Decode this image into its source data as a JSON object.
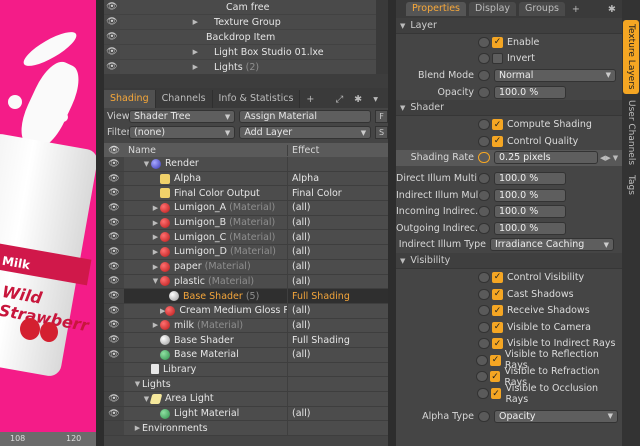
{
  "viewport": {
    "can_brand": "Milk",
    "can_flavor": "Wild Strawberr",
    "ruler": [
      "108",
      "120"
    ]
  },
  "scene_list": [
    {
      "label": "Cam free",
      "count": ""
    },
    {
      "label": "Texture Group",
      "count": ""
    },
    {
      "label": "Backdrop Item",
      "count": ""
    },
    {
      "label": "Light Box Studio 01.lxe",
      "count": ""
    },
    {
      "label": "Lights",
      "count": "(2)"
    }
  ],
  "shading_panel": {
    "tabs": [
      "Shading",
      "Channels",
      "Info & Statistics"
    ],
    "plus": "+",
    "view_label": "View",
    "view_value": "Shader Tree",
    "assign_button": "Assign Material",
    "f_button": "F",
    "filter_label": "Filter",
    "filter_value": "(none)",
    "add_layer_button": "Add Layer",
    "s_button": "S",
    "col_name": "Name",
    "col_effect": "Effect",
    "rows": [
      {
        "name": "Render",
        "tag": "",
        "effect": ""
      },
      {
        "name": "Alpha",
        "tag": "",
        "effect": "Alpha"
      },
      {
        "name": "Final Color Output",
        "tag": "",
        "effect": "Final Color"
      },
      {
        "name": "Lumigon_A",
        "tag": "(Material)",
        "effect": "(all)"
      },
      {
        "name": "Lumigon_B",
        "tag": "(Material)",
        "effect": "(all)"
      },
      {
        "name": "Lumigon_C",
        "tag": "(Material)",
        "effect": "(all)"
      },
      {
        "name": "Lumigon_D",
        "tag": "(Material)",
        "effect": "(all)"
      },
      {
        "name": "paper",
        "tag": "(Material)",
        "effect": "(all)"
      },
      {
        "name": "plastic",
        "tag": "(Material)",
        "effect": "(all)"
      },
      {
        "name": "Base Shader",
        "tag": "(5)",
        "effect": "Full Shading"
      },
      {
        "name": "Cream Medium Gloss Pl...",
        "tag": "",
        "effect": "(all)"
      },
      {
        "name": "milk",
        "tag": "(Material)",
        "effect": "(all)"
      },
      {
        "name": "Base Shader",
        "tag": "",
        "effect": "Full Shading"
      },
      {
        "name": "Base Material",
        "tag": "",
        "effect": "(all)"
      },
      {
        "name": "Library",
        "tag": "",
        "effect": ""
      },
      {
        "name": "Lights",
        "tag": "",
        "effect": ""
      },
      {
        "name": "Area Light",
        "tag": "",
        "effect": ""
      },
      {
        "name": "Light Material",
        "tag": "",
        "effect": "(all)"
      },
      {
        "name": "Environments",
        "tag": "",
        "effect": ""
      }
    ]
  },
  "properties": {
    "tabs": [
      "Properties",
      "Display",
      "Groups"
    ],
    "plus": "+",
    "sections": {
      "layer": "Layer",
      "shader": "Shader",
      "visibility": "Visibility"
    },
    "enable": "Enable",
    "invert": "Invert",
    "blend_mode_label": "Blend Mode",
    "blend_mode_value": "Normal",
    "opacity_label": "Opacity",
    "opacity_value": "100.0 %",
    "compute_shading": "Compute Shading",
    "control_quality": "Control Quality",
    "shading_rate_label": "Shading Rate",
    "shading_rate_value": "0.25 pixels",
    "direct_label": "Direct Illum Multi ...",
    "direct_value": "100.0 %",
    "indirect_label": "Indirect Illum Mul...",
    "indirect_value": "100.0 %",
    "incoming_label": "Incoming Indirec...",
    "incoming_value": "100.0 %",
    "outgoing_label": "Outgoing Indirec...",
    "outgoing_value": "100.0 %",
    "illum_type_label": "Indirect Illum Type",
    "illum_type_value": "Irradiance Caching",
    "vis_items": [
      "Control Visibility",
      "Cast Shadows",
      "Receive Shadows",
      "Visible to Camera",
      "Visible to Indirect Rays",
      "Visible to Reflection Rays",
      "Visible to Refraction Rays",
      "Visible to Occlusion Rays"
    ],
    "alpha_type_label": "Alpha Type",
    "alpha_type_value": "Opacity"
  },
  "side_tabs": [
    "Texture Layers",
    "User Channels",
    "Tags"
  ],
  "accent": "#f5a623"
}
